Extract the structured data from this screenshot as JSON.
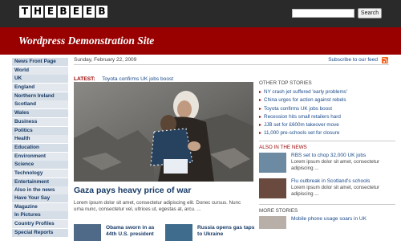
{
  "header": {
    "logo_letters": [
      "T",
      "H",
      "E",
      "B",
      "E",
      "E",
      "B"
    ],
    "search": {
      "value": "",
      "button_label": "Search"
    }
  },
  "banner": {
    "title": "Wordpress Demonstration Site"
  },
  "sidebar": {
    "main_items": [
      "News Front Page",
      "World",
      "UK",
      "England",
      "Northern Ireland",
      "Scotland",
      "Wales",
      "Business",
      "Politics",
      "Health",
      "Education",
      "Environment",
      "Science",
      "Technology",
      "Entertainment",
      "Also in the news"
    ],
    "secondary_items": [
      "Have Your Say",
      "Magazine",
      "In Pictures",
      "Country Profiles",
      "Special Reports"
    ]
  },
  "date_row": {
    "date": "Sunday, February 22, 2009",
    "subscribe": "Subscribe to our feed"
  },
  "latest": {
    "label": "LATEST:",
    "headline": "Toyota confirms UK jobs boost"
  },
  "feature": {
    "headline": "Gaza pays heavy price of war",
    "summary": "Lorem ipsum dolor sit amet, consectetur adipiscing elit. Donec cursus. Nunc urna nunc, consectetur vel, ultrices ut, egestas at, arcu. ..."
  },
  "thumb_stories": [
    {
      "title": "Obama sworn in as 44th U.S. president"
    },
    {
      "title": "Russia opens gas taps to Ukraine"
    }
  ],
  "other_top_stories": {
    "heading": "OTHER TOP STORIES",
    "items": [
      "NY crash jet suffered 'early problems'",
      "China urges for action against rebels",
      "Toyota confirms UK jobs boost",
      "Recession hits small retailers hard",
      "JJB set for £600m takeover move",
      "11,000 pre-schools set for closure"
    ]
  },
  "also_in_news": {
    "heading": "ALSO IN THE NEWS",
    "items": [
      {
        "title": "RBS set to chop 32,000 UK jobs",
        "desc": "Lorem ipsum dolor sit amet, consectetur adipiscing ..."
      },
      {
        "title": "Flu outbreak in Scotland's schools",
        "desc": "Lorem ipsum dolor sit amet, consectetur adipiscing ..."
      }
    ]
  },
  "more_stories": {
    "heading": "MORE STORIES",
    "items": [
      {
        "title": "Mobile phone usage soars in UK"
      }
    ]
  },
  "colors": {
    "topbar": "#2a2a2a",
    "banner": "#990000",
    "nav_bg": "#d5dde6",
    "link": "#1a4a8a",
    "nav_text": "#163a66"
  }
}
